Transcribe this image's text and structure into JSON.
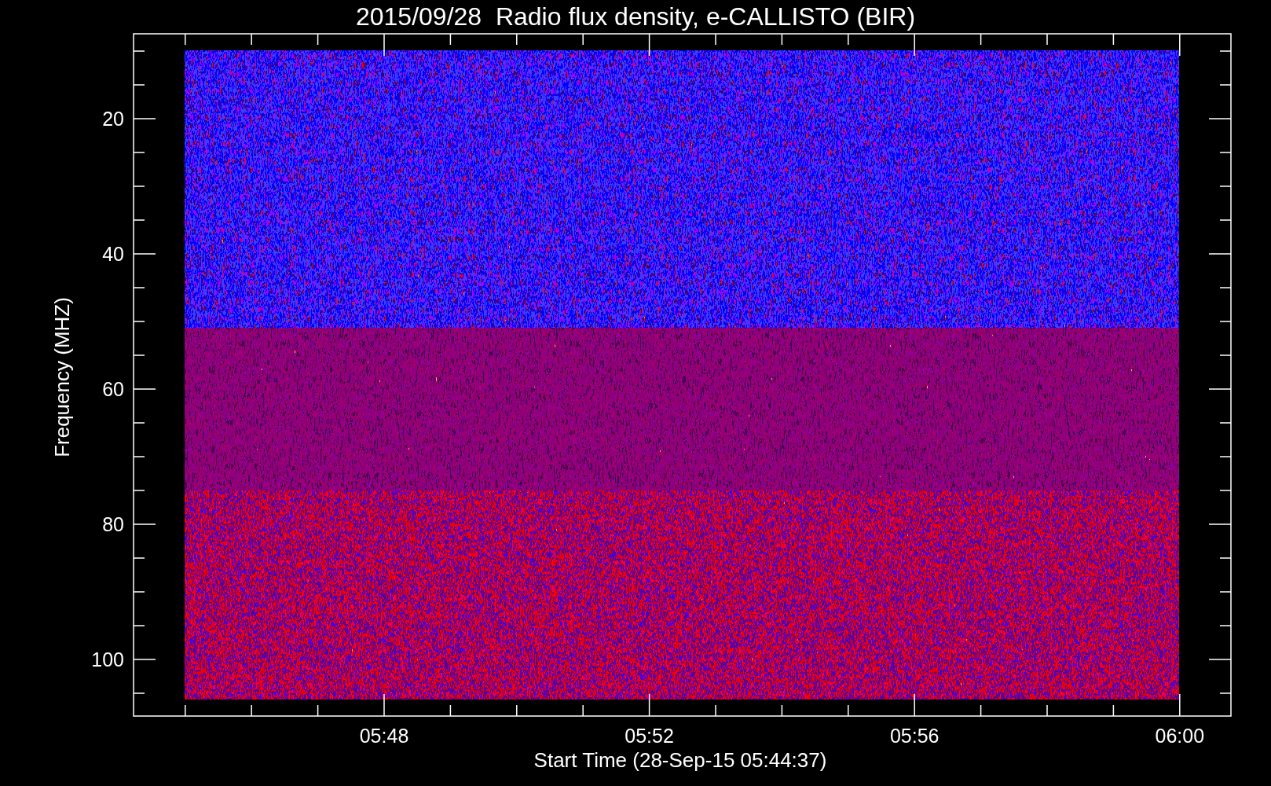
{
  "chart": {
    "title": "2015/09/28  Radio flux density, e-CALLISTO (BIR)",
    "ylabel": "Frequency (MHZ)",
    "xlabel": "Start Time (28-Sep-15 05:44:37)",
    "yticks": [
      "20",
      "40",
      "60",
      "80",
      "100"
    ],
    "xticks": [
      "05:48",
      "05:52",
      "05:56",
      "06:00"
    ]
  }
}
